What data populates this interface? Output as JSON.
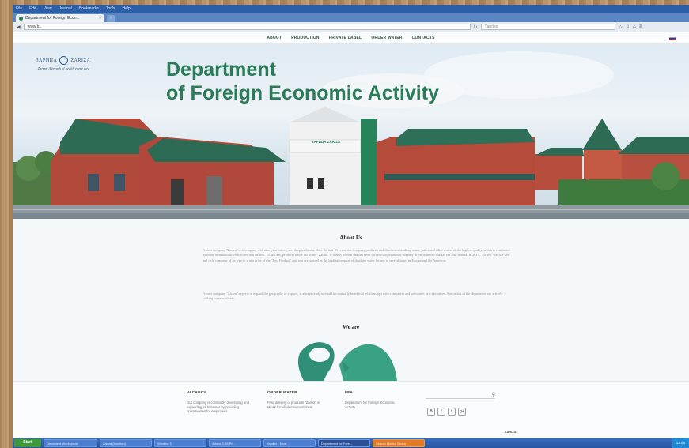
{
  "browser": {
    "menu": [
      "File",
      "Edit",
      "View",
      "Journal",
      "Bookmarks",
      "Tools",
      "Help"
    ],
    "tab_title": "Department for Foreign Econ...",
    "url": "www.b...",
    "search_placeholder": "Yandex",
    "newtab_label": "+"
  },
  "site": {
    "nav": [
      "ABOUT",
      "PRODUCTION",
      "PRIVATE LABEL",
      "ORDER WATER",
      "CONTACTS"
    ],
    "logo_left": "ЗАРИЦА",
    "logo_right": "ZARIZA",
    "logo_tagline": "Zariza. A breath of health every day",
    "hero_title_line1": "Department",
    "hero_title_line2": "of Foreign Economic Activity",
    "sign_text": "ЗАРИЦА ZARIZA",
    "about_title": "About Us",
    "about_p1": "Private company \"Zariza\" is a company with nine-year history and deep traditions. Over the last 10 years, our company produces and distributes drinking water, juices and other waters of the highest quality, which is confirmed by many international certificates and awards. To this day, products under the brand \"Zariza\" is widely known and has been successfully marketed not only in the domestic market but also abroad. In 2015, \"Zariza\" was the first and only company of its type to win a prize of the \"Best Product\" and was recognized as the leading supplier of drinking water for use in several states in Europe and the Americas.",
    "about_p2": "Private company \"Zariza\" expects to expand the geography of exports, is always ready to establish mutually beneficial relationships with companies and welcomes new initiatives. Specialists of the department are actively looking for new clients.",
    "we_are_title": "We are",
    "footer": {
      "col1_title": "VACANCY",
      "col1_text": "Our company is constantly developing and expanding its business by providing opportunities for employees",
      "col2_title": "ORDER WATER",
      "col2_text": "Free delivery of products \"Zariza\" in Minsk for wholesale customers",
      "col3_title": "FEA",
      "col3_text": "Department for Foreign Economic Activity",
      "social": [
        "B",
        "f",
        "t",
        "g+"
      ],
      "credit": "ZARIZA"
    }
  },
  "taskbar": {
    "start": "Start",
    "items": [
      "Document Workspace",
      "Zariza (function)",
      "Window 3",
      "Adobe CS5 Ph...",
      "Yandex - Mozi...",
      "Department for Forei...",
      "Search site for Zariza"
    ],
    "clock": "12:06"
  },
  "colors": {
    "accent_green": "#2a7c58",
    "browser_blue": "#2b5fa8"
  }
}
